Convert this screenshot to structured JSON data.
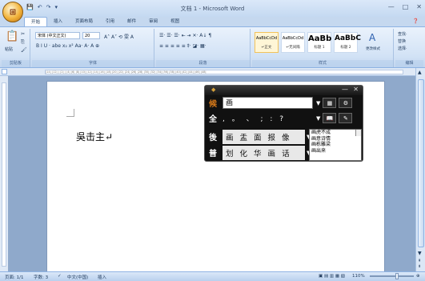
{
  "window": {
    "title": "文档 1 - Microsoft Word",
    "min": "—",
    "max": "□",
    "close": "✕"
  },
  "qat": [
    "💾",
    "↶",
    "↷",
    "▾"
  ],
  "tabs": [
    "开始",
    "插入",
    "页面布局",
    "引用",
    "邮件",
    "审阅",
    "视图"
  ],
  "help": "❓",
  "ribbon": {
    "clipboard": {
      "label": "剪贴板",
      "paste": "粘贴"
    },
    "font": {
      "label": "字体",
      "font_name": "宋体 (中文正文)",
      "font_size": "20",
      "row2": "B  I  U · abe  x₂  x²  Aa·  A·  A  ⊕"
    },
    "paragraph": {
      "label": "段落",
      "row1": "☰·  ☰·  ☰·  ⇤  ⇥  ✕·  A↓  ¶",
      "row2": "≡  ≡  ≡  ≡  ≡  ‡·  ◪·  ▦·"
    },
    "styles": {
      "label": "样式",
      "items": [
        {
          "sample": "AaBbCcDd",
          "name": "↵正文"
        },
        {
          "sample": "AaBbCcDd",
          "name": "↵无间隔"
        },
        {
          "sample": "AaBb",
          "name": "标题 1"
        },
        {
          "sample": "AaBbC",
          "name": "标题 2"
        }
      ],
      "change": "更改样式"
    },
    "editing": {
      "label": "编辑",
      "find": "查找·",
      "replace": "替换",
      "select": "选择·"
    }
  },
  "ruler_text": "|14|  |12|  |  |2|  |  |4|  |6|  |8|  |10|  |12|  |14|  |16|  |18|  |20|  |22|  |24|  |26|  |28|  |30|  |32|  |34|  |36|  |38|  |40|  |42|  |44|  |46|  |48|",
  "document": {
    "text": "吳击主↵"
  },
  "ime": {
    "input_tag": "候",
    "input_value": "画",
    "full_tag": "全",
    "punct": ", 。 、 ; : ? ",
    "row_back_tag": "後",
    "row_back": [
      "画",
      "盂",
      "面",
      "报",
      "像"
    ],
    "row_front_tag": "普",
    "row_front": [
      "划",
      "化",
      "华",
      "画",
      "话"
    ],
    "phrases": [
      "画虎不成",
      "画意诗情",
      "画栋雕梁",
      "画出来"
    ]
  },
  "status": {
    "page": "页面: 1/1",
    "words": "字数: 3",
    "lang": "中文(中国)",
    "insert": "插入",
    "zoom": "110%"
  }
}
